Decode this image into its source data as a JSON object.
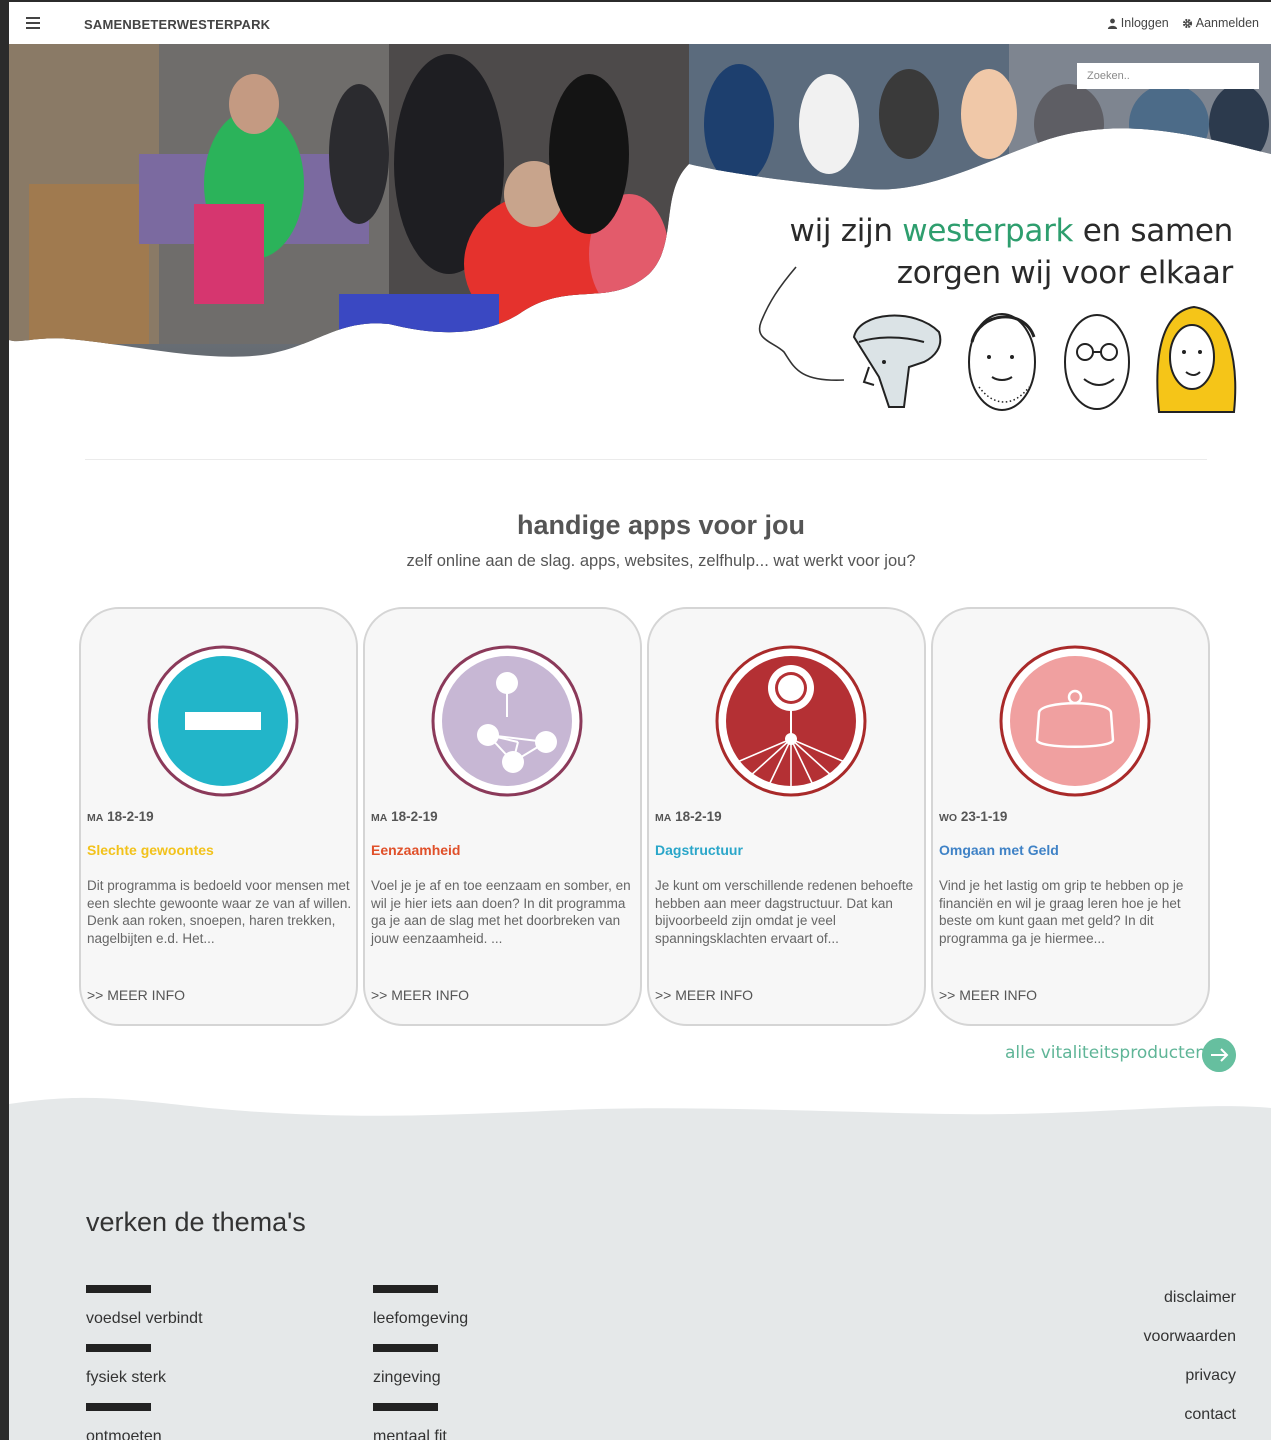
{
  "header": {
    "brand": "SAMENBETERWESTERPARK",
    "login_label": "Inloggen",
    "signup_label": "Aanmelden"
  },
  "hero": {
    "search_placeholder": "Zoeken..",
    "tagline_part1": "wij zijn ",
    "tagline_accent": "westerpark",
    "tagline_part2": " en samen",
    "tagline_line2": "zorgen wij voor elkaar"
  },
  "apps": {
    "title": "handige apps voor jou",
    "subtitle": "zelf online aan de slag. apps, websites, zelfhulp... wat werkt voor jou?",
    "cards": [
      {
        "dow": "MA",
        "date": "18-2-19",
        "title": "Slechte gewoontes",
        "title_color": "#f2c21b",
        "icon": "no-entry-icon",
        "desc": "Dit programma is bedoeld voor mensen met een slechte gewoonte waar ze van af willen. Denk aan roken, snoepen, haren trekken, nagelbijten e.d. Het...",
        "more": ">> MEER INFO"
      },
      {
        "dow": "MA",
        "date": "18-2-19",
        "title": "Eenzaamheid",
        "title_color": "#e0502a",
        "icon": "network-icon",
        "desc": "Voel je je af en toe eenzaam en somber, en wil je hier iets aan doen? In dit programma ga je aan de slag met het doorbreken van jouw eenzaamheid. ...",
        "more": ">> MEER INFO"
      },
      {
        "dow": "MA",
        "date": "18-2-19",
        "title": "Dagstructuur",
        "title_color": "#2aa6c9",
        "icon": "parachute-icon",
        "desc": "Je kunt om verschillende redenen behoefte hebben aan meer dagstructuur. Dat kan bijvoorbeeld zijn omdat je veel spanningsklachten ervaart of...",
        "more": ">> MEER INFO"
      },
      {
        "dow": "WO",
        "date": "23-1-19",
        "title": "Omgaan met Geld",
        "title_color": "#3f82c6",
        "icon": "purse-icon",
        "desc": "Vind je het lastig om grip te hebben op je financiën en wil je graag leren hoe je het beste om kunt gaan met geld? In dit programma ga je hiermee...",
        "more": ">> MEER INFO"
      }
    ],
    "all_link": "alle vitaliteitsproducten"
  },
  "footer": {
    "themes_title": "verken de thema's",
    "themes_col1": [
      "voedsel verbindt",
      "fysiek sterk",
      "ontmoeten"
    ],
    "themes_col2": [
      "leefomgeving",
      "zingeving",
      "mentaal fit"
    ],
    "links": [
      "disclaimer",
      "voorwaarden",
      "privacy",
      "contact"
    ]
  }
}
